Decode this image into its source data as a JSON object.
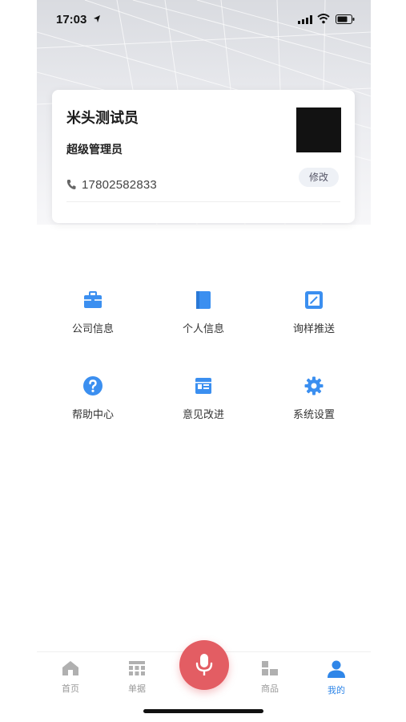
{
  "status_bar": {
    "time": "17:03"
  },
  "profile": {
    "name": "米头测试员",
    "role": "超级管理员",
    "phone": "17802582833",
    "edit_label": "修改"
  },
  "menu": [
    {
      "label": "公司信息",
      "icon": "briefcase-icon"
    },
    {
      "label": "个人信息",
      "icon": "book-icon"
    },
    {
      "label": "询样推送",
      "icon": "edit-sheet-icon"
    },
    {
      "label": "帮助中心",
      "icon": "question-icon"
    },
    {
      "label": "意见改进",
      "icon": "feedback-icon"
    },
    {
      "label": "系统设置",
      "icon": "gear-icon"
    }
  ],
  "tabs": [
    {
      "label": "首页",
      "icon": "home-icon"
    },
    {
      "label": "单据",
      "icon": "grid-icon"
    },
    {
      "label": "商品",
      "icon": "blocks-icon"
    },
    {
      "label": "我的",
      "icon": "user-icon",
      "active": true
    }
  ],
  "colors": {
    "accent": "#2f86e8",
    "mic": "#e35d63",
    "icon_blue": "#3b8ff0"
  }
}
